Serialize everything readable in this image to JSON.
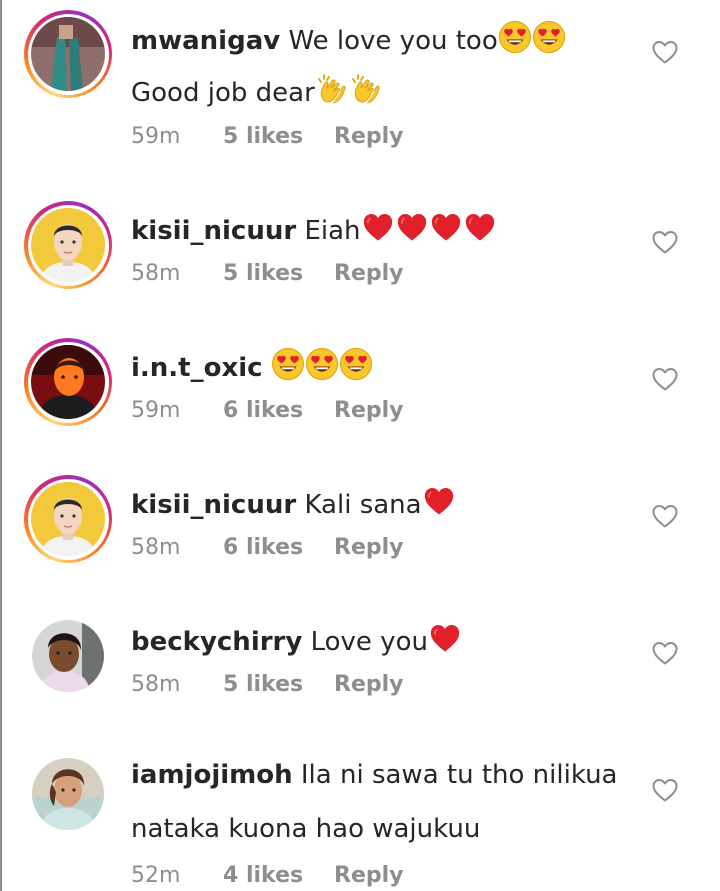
{
  "comments": [
    {
      "username": "mwanigav",
      "text_lines": [
        "We love you too",
        "Good job dear"
      ],
      "emojis": [
        "heart-eyes",
        "heart-eyes",
        "clapping-hands",
        "clapping-hands"
      ],
      "time": "59m",
      "likes": "5 likes",
      "reply": "Reply",
      "has_story_ring": true
    },
    {
      "username": "kisii_nicuur",
      "text_lines": [
        "Eiah"
      ],
      "emojis": [
        "red-heart",
        "red-heart",
        "red-heart",
        "red-heart"
      ],
      "time": "58m",
      "likes": "5 likes",
      "reply": "Reply",
      "has_story_ring": true
    },
    {
      "username": "i.n.t_oxic",
      "text_lines": [
        ""
      ],
      "emojis": [
        "heart-eyes",
        "heart-eyes",
        "heart-eyes"
      ],
      "time": "59m",
      "likes": "6 likes",
      "reply": "Reply",
      "has_story_ring": true
    },
    {
      "username": "kisii_nicuur",
      "text_lines": [
        "Kali sana"
      ],
      "emojis": [
        "red-heart"
      ],
      "time": "58m",
      "likes": "6 likes",
      "reply": "Reply",
      "has_story_ring": true
    },
    {
      "username": "beckychirry",
      "text_lines": [
        "Love you"
      ],
      "emojis": [
        "red-heart"
      ],
      "time": "58m",
      "likes": "5 likes",
      "reply": "Reply",
      "has_story_ring": false
    },
    {
      "username": "iamjojimoh",
      "text_lines": [
        "Ila ni sawa tu tho nilikua",
        "nataka kuona hao wajukuu"
      ],
      "emojis": [],
      "time": "52m",
      "likes": "4 likes",
      "reply": "Reply",
      "has_story_ring": false
    }
  ],
  "colors": {
    "meta_text": "#8e8e8e",
    "primary_text": "#262626",
    "heart_red": "#e0202a",
    "emoji_yellow": "#f9c62c"
  }
}
